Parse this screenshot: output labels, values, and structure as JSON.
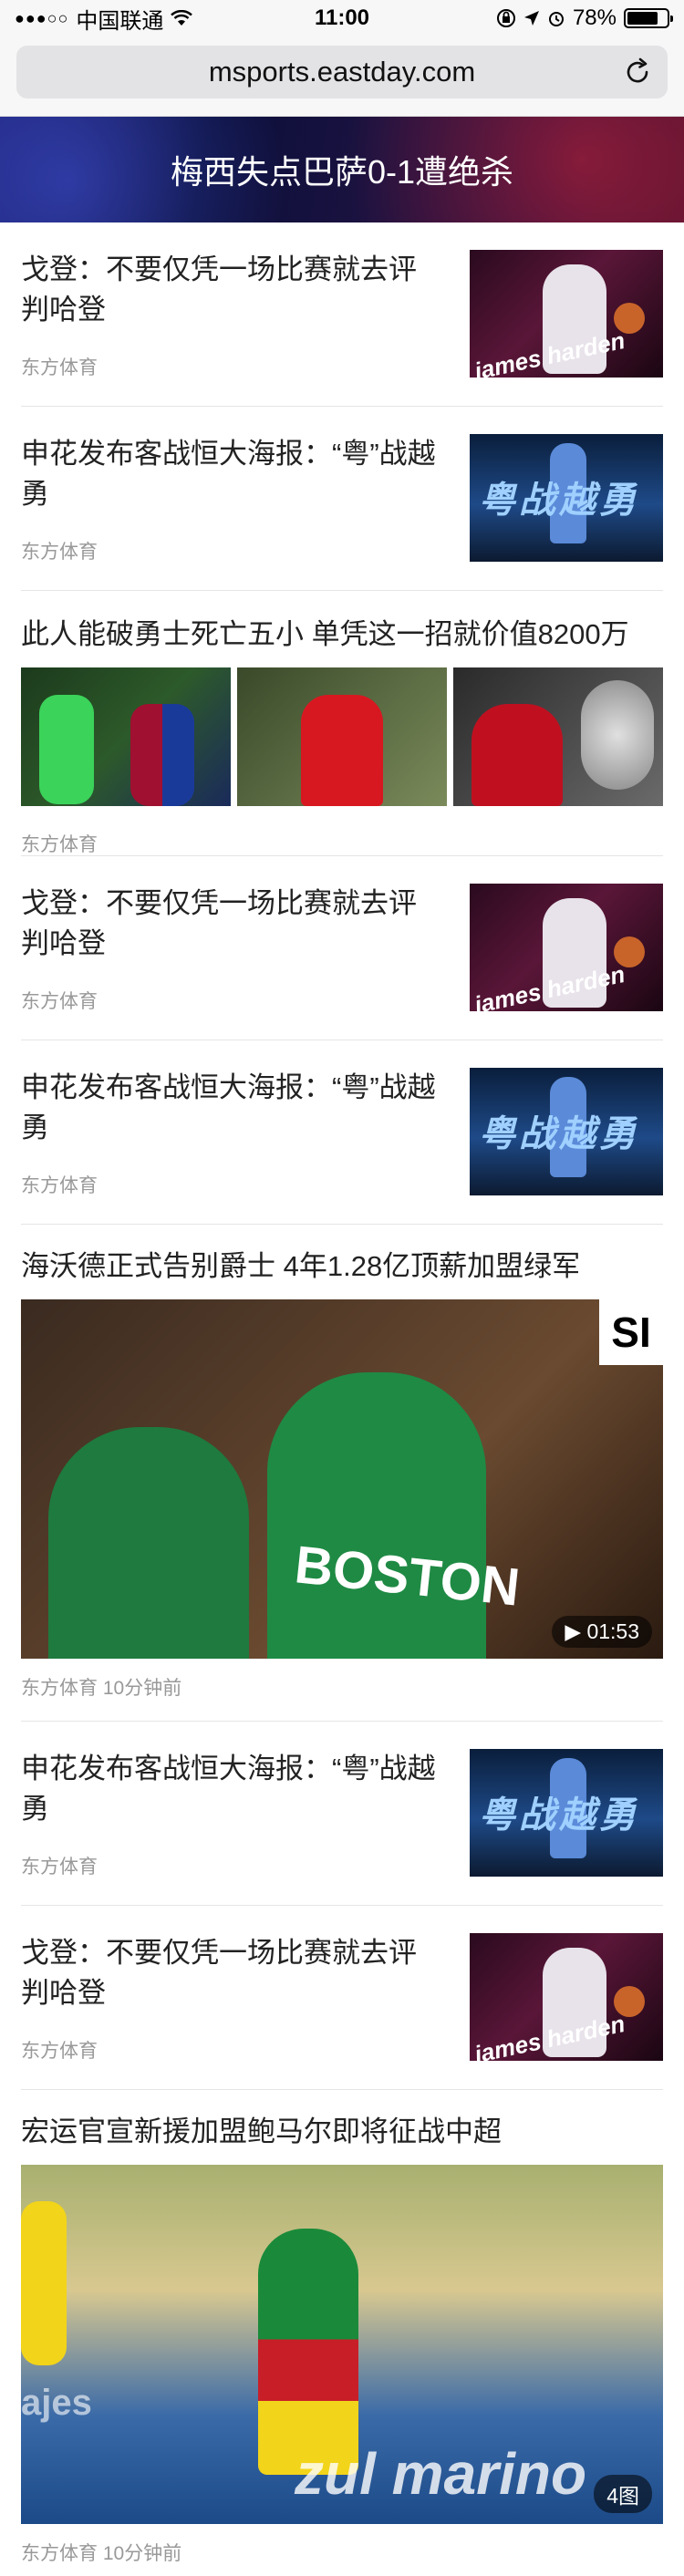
{
  "status_bar": {
    "signal": "●●●○○",
    "carrier": "中国联通",
    "time": "11:00",
    "battery": "78%",
    "battery_level": 0.78
  },
  "address_bar": {
    "url": "msports.eastday.com"
  },
  "banner": {
    "title": "梅西失点巴萨0-1遭绝杀"
  },
  "feed": [
    {
      "type": "single",
      "title": "戈登：不要仅凭一场比赛就去评判哈登",
      "source": "东方体育",
      "thumb_text": "james harden"
    },
    {
      "type": "single",
      "title": "申花发布客战恒大海报：“粤”战越勇",
      "source": "东方体育",
      "thumb_text": "粤战越勇"
    },
    {
      "type": "three",
      "title": "此人能破勇士死亡五小 单凭这一招就价值8200万",
      "source": "东方体育"
    },
    {
      "type": "single",
      "title": "戈登：不要仅凭一场比赛就去评判哈登",
      "source": "东方体育",
      "thumb_text": "james harden"
    },
    {
      "type": "single",
      "title": "申花发布客战恒大海报：“粤”战越勇",
      "source": "东方体育",
      "thumb_text": "粤战越勇"
    },
    {
      "type": "video",
      "title": "海沃德正式告别爵士 4年1.28亿顶薪加盟绿军",
      "source": "东方体育",
      "time": "10分钟前",
      "duration": "▶ 01:53",
      "jersey": "BOSTON",
      "corner_logo": "SI"
    },
    {
      "type": "single",
      "title": "申花发布客战恒大海报：“粤”战越勇",
      "source": "东方体育",
      "thumb_text": "粤战越勇"
    },
    {
      "type": "single",
      "title": "戈登：不要仅凭一场比赛就去评判哈登",
      "source": "东方体育",
      "thumb_text": "james harden"
    },
    {
      "type": "gallery",
      "title": "宏运官宣新援加盟鲍马尔即将征战中超",
      "source": "东方体育",
      "time": "10分钟前",
      "count": "4图",
      "ad_text": "zul marino",
      "ad_text2": "ajes"
    }
  ]
}
